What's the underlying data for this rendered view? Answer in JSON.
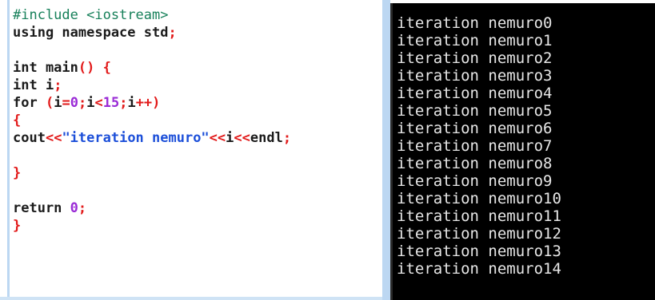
{
  "editor": {
    "lines": [
      [
        {
          "t": "#include <iostream>",
          "c": "directive"
        }
      ],
      [
        {
          "t": "using namespace std",
          "c": "keyword"
        },
        {
          "t": ";",
          "c": "punct"
        }
      ],
      [],
      [
        {
          "t": "int main",
          "c": "keyword"
        },
        {
          "t": "() {",
          "c": "punct"
        }
      ],
      [
        {
          "t": "int i",
          "c": "keyword"
        },
        {
          "t": ";",
          "c": "punct"
        }
      ],
      [
        {
          "t": "for ",
          "c": "keyword"
        },
        {
          "t": "(",
          "c": "punct"
        },
        {
          "t": "i",
          "c": "ident"
        },
        {
          "t": "=",
          "c": "punct"
        },
        {
          "t": "0",
          "c": "number"
        },
        {
          "t": ";",
          "c": "punct"
        },
        {
          "t": "i",
          "c": "ident"
        },
        {
          "t": "<",
          "c": "punct"
        },
        {
          "t": "15",
          "c": "number"
        },
        {
          "t": ";",
          "c": "punct"
        },
        {
          "t": "i",
          "c": "ident"
        },
        {
          "t": "++)",
          "c": "punct"
        }
      ],
      [
        {
          "t": "{",
          "c": "punct"
        }
      ],
      [
        {
          "t": "cout",
          "c": "ident"
        },
        {
          "t": "<<",
          "c": "punct"
        },
        {
          "t": "\"iteration nemuro\"",
          "c": "string"
        },
        {
          "t": "<<",
          "c": "punct"
        },
        {
          "t": "i",
          "c": "ident"
        },
        {
          "t": "<<",
          "c": "punct"
        },
        {
          "t": "endl",
          "c": "ident"
        },
        {
          "t": ";",
          "c": "punct"
        }
      ],
      [],
      [
        {
          "t": "}",
          "c": "punct"
        }
      ],
      [],
      [
        {
          "t": "return ",
          "c": "keyword"
        },
        {
          "t": "0",
          "c": "number"
        },
        {
          "t": ";",
          "c": "punct"
        }
      ],
      [
        {
          "t": "}",
          "c": "punct"
        }
      ]
    ]
  },
  "console": {
    "lines": [
      "iteration nemuro0",
      "iteration nemuro1",
      "iteration nemuro2",
      "iteration nemuro3",
      "iteration nemuro4",
      "iteration nemuro5",
      "iteration nemuro6",
      "iteration nemuro7",
      "iteration nemuro8",
      "iteration nemuro9",
      "iteration nemuro10",
      "iteration nemuro11",
      "iteration nemuro12",
      "iteration nemuro13",
      "iteration nemuro14"
    ]
  },
  "colors": {
    "directive": "#17805a",
    "keyword": "#1b1b1b",
    "punct": "#e21a1a",
    "number": "#9a2bd6",
    "string": "#1c4fd9",
    "console_bg": "#000000",
    "console_text": "#e6e6e6",
    "splitter": "#bcd7f2"
  }
}
